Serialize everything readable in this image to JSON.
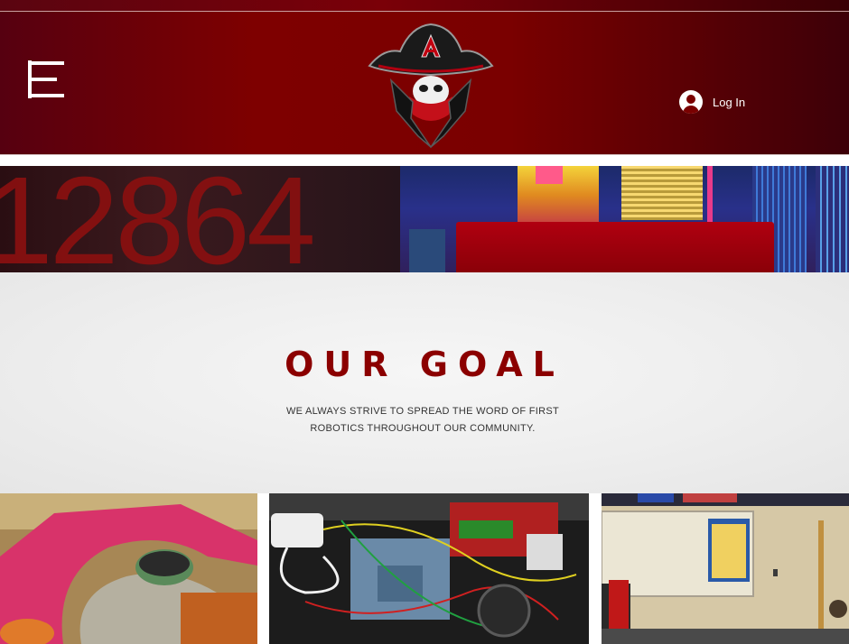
{
  "header": {
    "menu_icon": "hamburger-menu-icon",
    "logo_icon": "pirate-mascot-logo",
    "login_label": "Log In",
    "login_icon": "user-avatar-icon",
    "colors": {
      "primary": "#7a0000",
      "dark": "#3d0008",
      "text": "#ffffff"
    }
  },
  "banner": {
    "number_text": "12864"
  },
  "goal": {
    "title": "OUR GOAL",
    "line1": "WE ALWAYS STRIVE TO SPREAD THE WORD OF FIRST",
    "line2": "ROBOTICS THROUGHOUT OUR COMMUNITY.",
    "title_color": "#8b0000"
  },
  "gallery": {
    "items": [
      {
        "subject": "robot-field-element-photo"
      },
      {
        "subject": "robot-electronics-photo"
      },
      {
        "subject": "classroom-photo"
      }
    ]
  }
}
